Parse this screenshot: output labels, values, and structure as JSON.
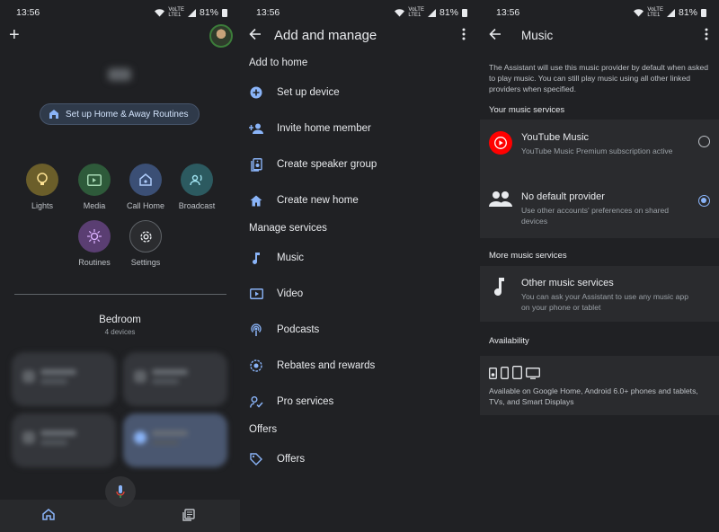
{
  "status_bar": {
    "time": "13:56",
    "battery": "81%",
    "net_top": "VoLTE",
    "net_bottom": "LTE1"
  },
  "home_screen": {
    "routine_button": "Set up Home & Away Routines",
    "actions": [
      {
        "label": "Lights",
        "icon": "lightbulb-icon",
        "color": "#6b5e2a"
      },
      {
        "label": "Media",
        "icon": "media-icon",
        "color": "#2e5a3a"
      },
      {
        "label": "Call Home",
        "icon": "call-home-icon",
        "color": "#3b4f75"
      },
      {
        "label": "Broadcast",
        "icon": "broadcast-icon",
        "color": "#2c5a60"
      },
      {
        "label": "Routines",
        "icon": "routines-icon",
        "color": "#5a3e72"
      },
      {
        "label": "Settings",
        "icon": "settings-icon",
        "color": "#2b2c2f"
      }
    ],
    "room_name": "Bedroom",
    "room_subtitle": "4 devices"
  },
  "add_manage": {
    "title": "Add and manage",
    "sections": {
      "add_to_home": "Add to home",
      "manage_services": "Manage services",
      "offers": "Offers"
    },
    "add_items": [
      {
        "label": "Set up device",
        "icon": "add-circle-icon"
      },
      {
        "label": "Invite home member",
        "icon": "person-add-icon"
      },
      {
        "label": "Create speaker group",
        "icon": "speaker-group-icon"
      },
      {
        "label": "Create new home",
        "icon": "home-icon"
      }
    ],
    "manage_items": [
      {
        "label": "Music",
        "icon": "music-note-icon"
      },
      {
        "label": "Video",
        "icon": "video-icon"
      },
      {
        "label": "Podcasts",
        "icon": "podcast-icon"
      },
      {
        "label": "Rebates and rewards",
        "icon": "rewards-icon"
      },
      {
        "label": "Pro services",
        "icon": "pro-services-icon"
      }
    ],
    "offer_items": [
      {
        "label": "Offers",
        "icon": "tag-icon"
      }
    ]
  },
  "music": {
    "title": "Music",
    "description": "The Assistant will use this music provider by default when asked to play music. You can still play music using all other linked providers when specified.",
    "your_services_header": "Your music services",
    "services": [
      {
        "name": "YouTube Music",
        "subtitle": "YouTube Music Premium subscription active",
        "selected": false
      },
      {
        "name": "No default provider",
        "subtitle": "Use other accounts' preferences on shared devices",
        "selected": true
      }
    ],
    "more_header": "More music services",
    "other": {
      "name": "Other music services",
      "subtitle": "You can ask your Assistant to use any music app on your phone or tablet"
    },
    "availability_header": "Availability",
    "availability_text": "Available on Google Home, Android 6.0+ phones and tablets, TVs, and Smart Displays",
    "accent_color": "#8ab4f8",
    "youtube_red": "#ff0000"
  }
}
